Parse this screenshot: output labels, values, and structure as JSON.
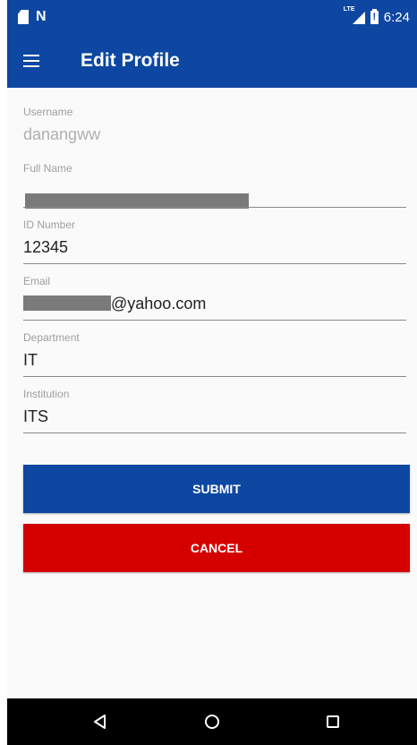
{
  "status_bar": {
    "time": "6:24",
    "signal_label": "LTE",
    "icons": [
      "sd-card-icon",
      "n-notification-icon",
      "lte-signal-icon",
      "battery-alert-icon"
    ]
  },
  "toolbar": {
    "title": "Edit Profile",
    "menu_icon": "hamburger-menu-icon"
  },
  "form": {
    "fields": [
      {
        "label": "Username",
        "value": "danangww",
        "enabled": false
      },
      {
        "label": "Full Name",
        "value": "",
        "redacted": true
      },
      {
        "label": "ID Number",
        "value": "12345"
      },
      {
        "label": "Email",
        "value": "@yahoo.com",
        "redacted_prefix": true
      },
      {
        "label": "Department",
        "value": "IT"
      },
      {
        "label": "Institution",
        "value": "ITS"
      }
    ]
  },
  "actions": {
    "submit_label": "SUBMIT",
    "cancel_label": "CANCEL"
  },
  "nav_bar": {
    "buttons": [
      "back-icon",
      "home-icon",
      "recent-apps-icon"
    ]
  },
  "colors": {
    "primary": "#0d47a1",
    "danger": "#d50000",
    "nav_bar": "#000000"
  }
}
